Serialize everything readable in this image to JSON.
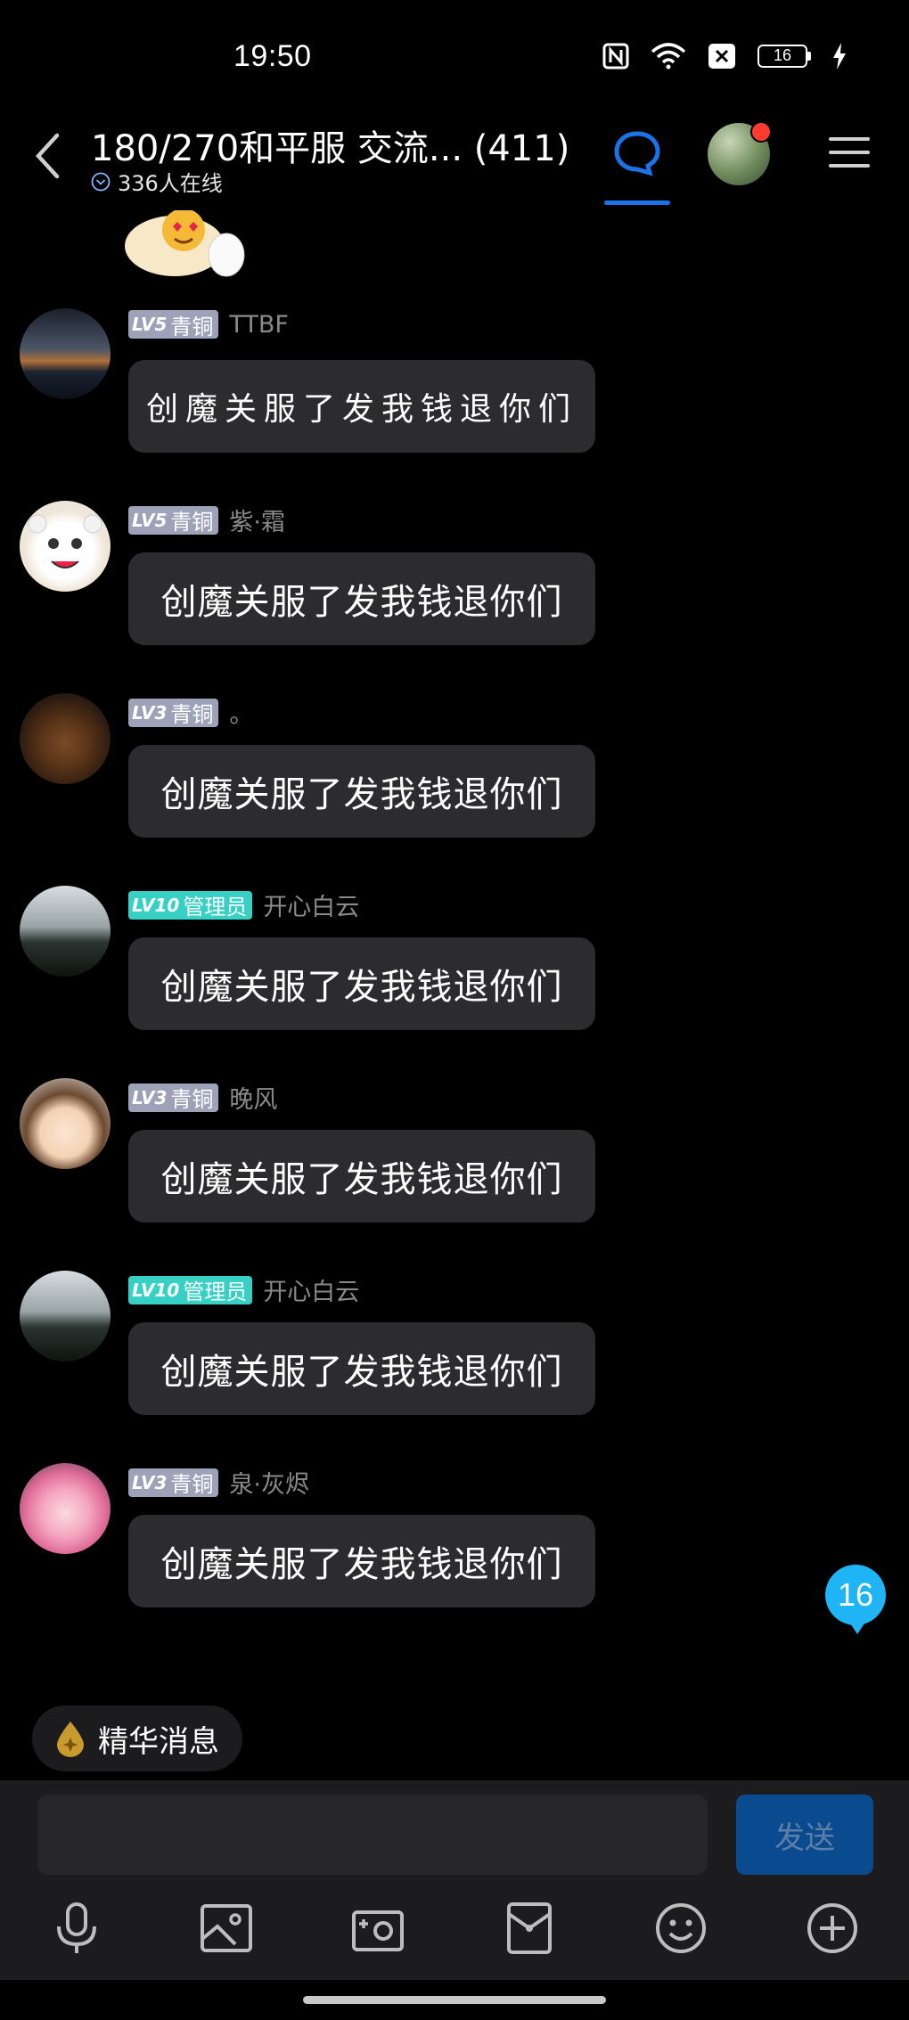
{
  "status": {
    "time": "19:50",
    "battery": "16"
  },
  "header": {
    "title": "180/270和平服 交流...  (411)",
    "online": "336人在线"
  },
  "messages": [
    {
      "level": "LV5",
      "rank": "青铜",
      "name": "TTBF",
      "text": "创魔关服了发我钱退你们"
    },
    {
      "level": "LV5",
      "rank": "青铜",
      "name": "紫·霜",
      "text": "创魔关服了发我钱退你们"
    },
    {
      "level": "LV3",
      "rank": "青铜",
      "name": "。",
      "text": "创魔关服了发我钱退你们"
    },
    {
      "level": "LV10",
      "rank": "管理员",
      "name": "开心白云",
      "text": "创魔关服了发我钱退你们"
    },
    {
      "level": "LV3",
      "rank": "青铜",
      "name": "晚风",
      "text": "创魔关服了发我钱退你们"
    },
    {
      "level": "LV10",
      "rank": "管理员",
      "name": "开心白云",
      "text": "创魔关服了发我钱退你们"
    },
    {
      "level": "LV3",
      "rank": "青铜",
      "name": "泉·灰烬",
      "text": "创魔关服了发我钱退你们"
    }
  ],
  "unread_count": "16",
  "essence_label": "精华消息",
  "composer": {
    "send_label": "发送",
    "input_value": ""
  },
  "toolbar": [
    "mic-icon",
    "image-icon",
    "camera-icon",
    "red-packet-icon",
    "emoji-icon",
    "plus-icon"
  ],
  "colors": {
    "accent": "#1a73e8",
    "bronze_badge": "#9ea2b8",
    "admin_badge": "#36d1c4",
    "unread": "#1fb4f5"
  }
}
